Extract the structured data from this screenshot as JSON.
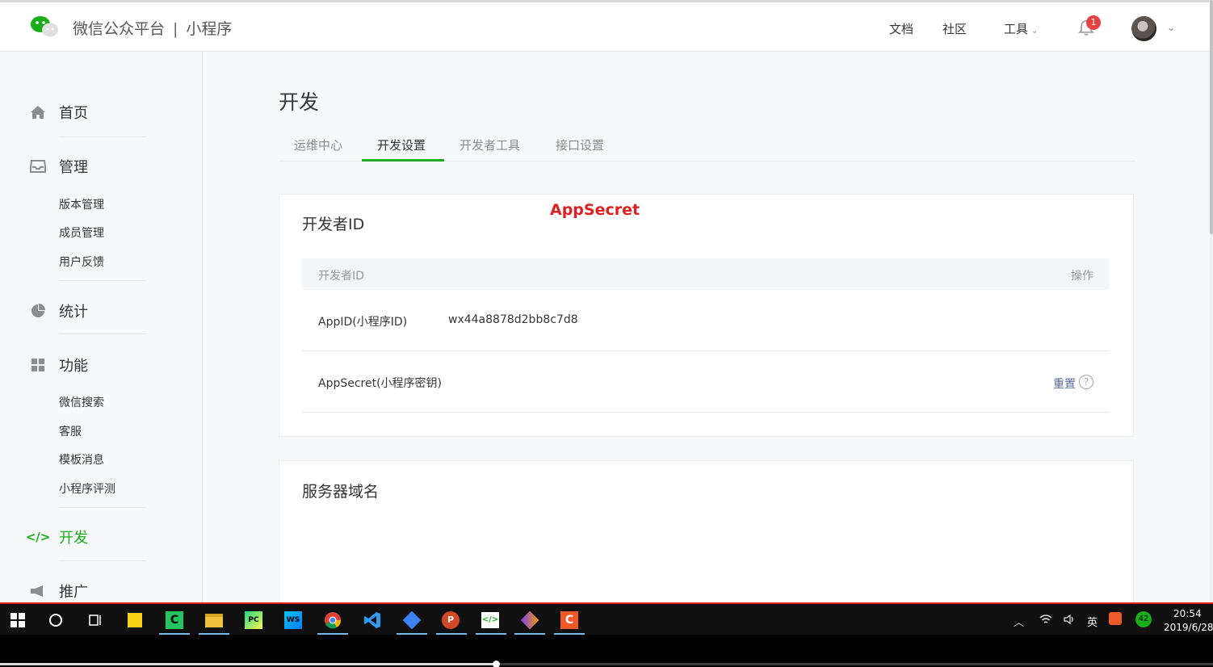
{
  "header": {
    "brand": "微信公众平台",
    "separator": "|",
    "product": "小程序",
    "links": [
      "文档",
      "社区",
      "工具"
    ],
    "notification_count": "1",
    "icons": [
      "wechat-logo",
      "bell-icon",
      "avatar",
      "chevron-down-icon"
    ]
  },
  "sidebar": {
    "home": "首页",
    "manage": "管理",
    "manage_items": [
      "版本管理",
      "成员管理",
      "用户反馈"
    ],
    "stats": "统计",
    "features": "功能",
    "feature_items": [
      "微信搜索",
      "客服",
      "模板消息",
      "小程序评测"
    ],
    "dev": "开发",
    "promo": "推广"
  },
  "main": {
    "title": "开发",
    "tabs": [
      "运维中心",
      "开发设置",
      "开发者工具",
      "接口设置"
    ],
    "active_tab": "开发设置",
    "annotation": "AppSecret",
    "developer_id_card": {
      "title": "开发者ID",
      "columns": [
        "开发者ID",
        "操作"
      ],
      "rows": [
        {
          "label": "AppID(小程序ID)",
          "value": "wx44a8878d2bb8c7d8",
          "action": ""
        },
        {
          "label": "AppSecret(小程序密钥)",
          "value": "",
          "action": "重置"
        }
      ],
      "help_glyph": "?"
    },
    "server_domain_card": {
      "title": "服务器域名"
    }
  },
  "taskbar": {
    "tray_ime": "英",
    "tray_badge": "42",
    "time": "20:54",
    "date": "2019/6/28"
  },
  "colors": {
    "accent_green": "#1aad19",
    "link_blue": "#576b95",
    "annotation_red": "#e02020",
    "badge_red": "#e64340"
  },
  "video_progress": 0.41
}
